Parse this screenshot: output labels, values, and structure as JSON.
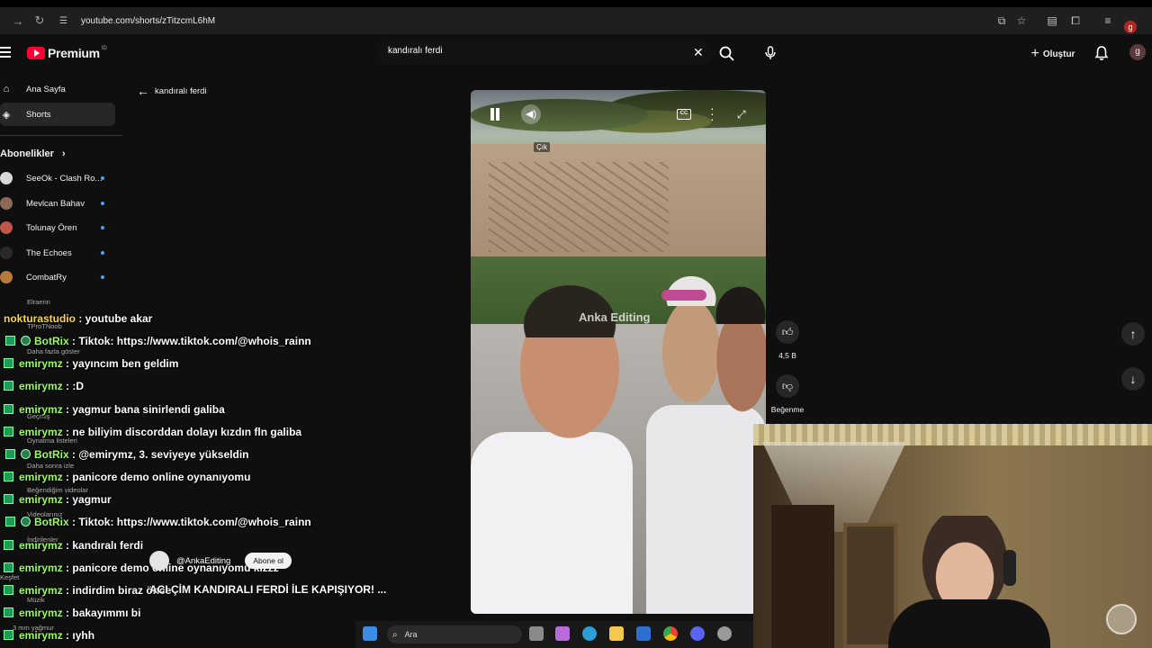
{
  "browser": {
    "url": "youtube.com/shorts/zTitzcmL6hM",
    "profile_letter": "g"
  },
  "header": {
    "logo_text": "Premium",
    "logo_sup": "ID",
    "search_value": "kandıralı ferdi",
    "create_label": "Oluştur",
    "avatar_letter": "g"
  },
  "sidebar": {
    "items": [
      {
        "label": "Ana Sayfa",
        "icon": "home-icon"
      },
      {
        "label": "Shorts",
        "icon": "shorts-icon"
      }
    ],
    "subs_title": "Abonelikler",
    "subscriptions": [
      {
        "label": "SeeOk - Clash Ro...",
        "color": "#d8d8d8"
      },
      {
        "label": "Mevlcan Bahav",
        "color": "#8a6a55"
      },
      {
        "label": "Tolunay Ören",
        "color": "#c0564a"
      },
      {
        "label": "The Echoes",
        "color": "#2a2a2a"
      },
      {
        "label": "CombatRy",
        "color": "#b67a3a"
      }
    ],
    "faint_items": [
      "Elraenn",
      "TProTNoob",
      "Daha fazla göster",
      "Geçmiş",
      "Oynatma listeleri",
      "Daha sonra izle",
      "Beğendiğim videolar",
      "Videolarınız",
      "İndirilenler",
      "Keşfet",
      "Müzik",
      "3 mm yağmur"
    ]
  },
  "back": {
    "label": "kandıralı ferdi"
  },
  "video": {
    "watermark": "Anka Editing",
    "tooltip": "Çık",
    "cc_label": "CC",
    "channel": "@AnkaEditing",
    "subscribe_label": "Abone ol",
    "title": "ACI ÇİM KANDIRALI FERDİ İLE KAPIŞIYOR! ..."
  },
  "actions": {
    "like_count": "4,5 B",
    "dislike_label": "Beğenme"
  },
  "chat": [
    {
      "user": "nokturastudio",
      "msg": " : youtube akar",
      "type": "nok"
    },
    {
      "user": "BotRix",
      "msg": " : Tiktok: https://www.tiktok.com/@whois_rainn",
      "type": "bot"
    },
    {
      "user": "emirymz",
      "msg": " : yayıncım ben geldim",
      "type": "user"
    },
    {
      "user": "emirymz",
      "msg": " : :D",
      "type": "user"
    },
    {
      "user": "emirymz",
      "msg": " : yagmur bana sinirlendi galiba",
      "type": "user"
    },
    {
      "user": "emirymz",
      "msg": " : ne biliyim discorddan dolayı kızdın fln galiba",
      "type": "user"
    },
    {
      "user": "BotRix",
      "msg": " : @emirymz, 3. seviyeye yükseldin",
      "type": "bot"
    },
    {
      "user": "emirymz",
      "msg": " : panicore demo online oynanıyomu",
      "type": "user"
    },
    {
      "user": "emirymz",
      "msg": " : yagmur",
      "type": "user"
    },
    {
      "user": "BotRix",
      "msg": " : Tiktok: https://www.tiktok.com/@whois_rainn",
      "type": "bot"
    },
    {
      "user": "emirymz",
      "msg": " : kandıralı ferdi",
      "type": "user"
    },
    {
      "user": "emirymz",
      "msg": " : panicore demo online oynanıyomu kızzz",
      "type": "user"
    },
    {
      "user": "emirymz",
      "msg": " : indirdim biraz önce",
      "type": "user"
    },
    {
      "user": "emirymz",
      "msg": " : bakayımmı bi",
      "type": "user"
    },
    {
      "user": "emirymz",
      "msg": " : ıyhh",
      "type": "user"
    }
  ],
  "taskbar": {
    "search_label": "Ara"
  }
}
